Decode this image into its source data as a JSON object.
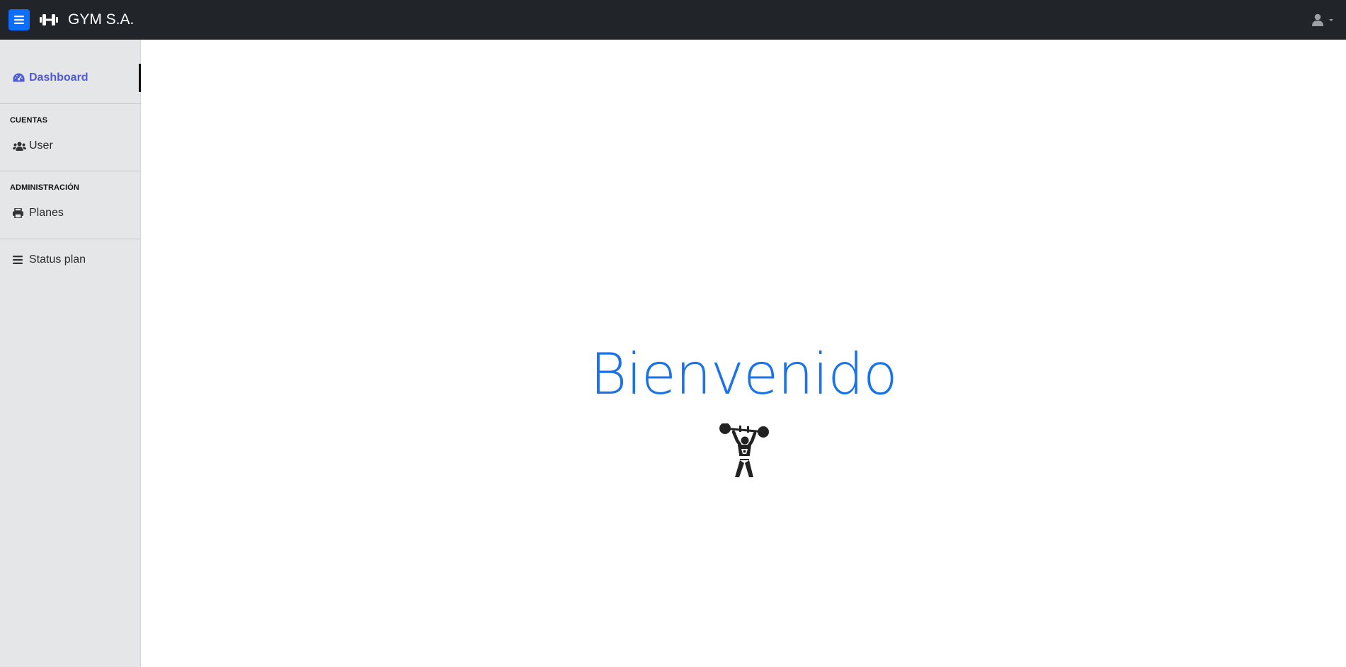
{
  "topbar": {
    "brand": "GYM S.A.",
    "toggle_icon": "bars-icon",
    "logo_icon": "dumbbell-icon",
    "user_icon": "user-icon",
    "accent_color": "#0d6efd",
    "background_color": "#212529"
  },
  "sidebar": {
    "dashboard": {
      "label": "Dashboard",
      "icon": "tachometer-icon",
      "active": true,
      "color": "#4f5bd5"
    },
    "sections": [
      {
        "heading": "CUENTAS",
        "items": [
          {
            "label": "User",
            "icon": "users-icon"
          }
        ]
      },
      {
        "heading": "ADMINISTRACIÓN",
        "items": [
          {
            "label": "Planes",
            "icon": "print-icon"
          }
        ]
      }
    ],
    "status_plan": {
      "label": "Status plan",
      "icon": "bars-icon"
    }
  },
  "main": {
    "welcome": "Bienvenido",
    "welcome_color": "#1a73e8",
    "illustration": "weightlifter-icon"
  }
}
